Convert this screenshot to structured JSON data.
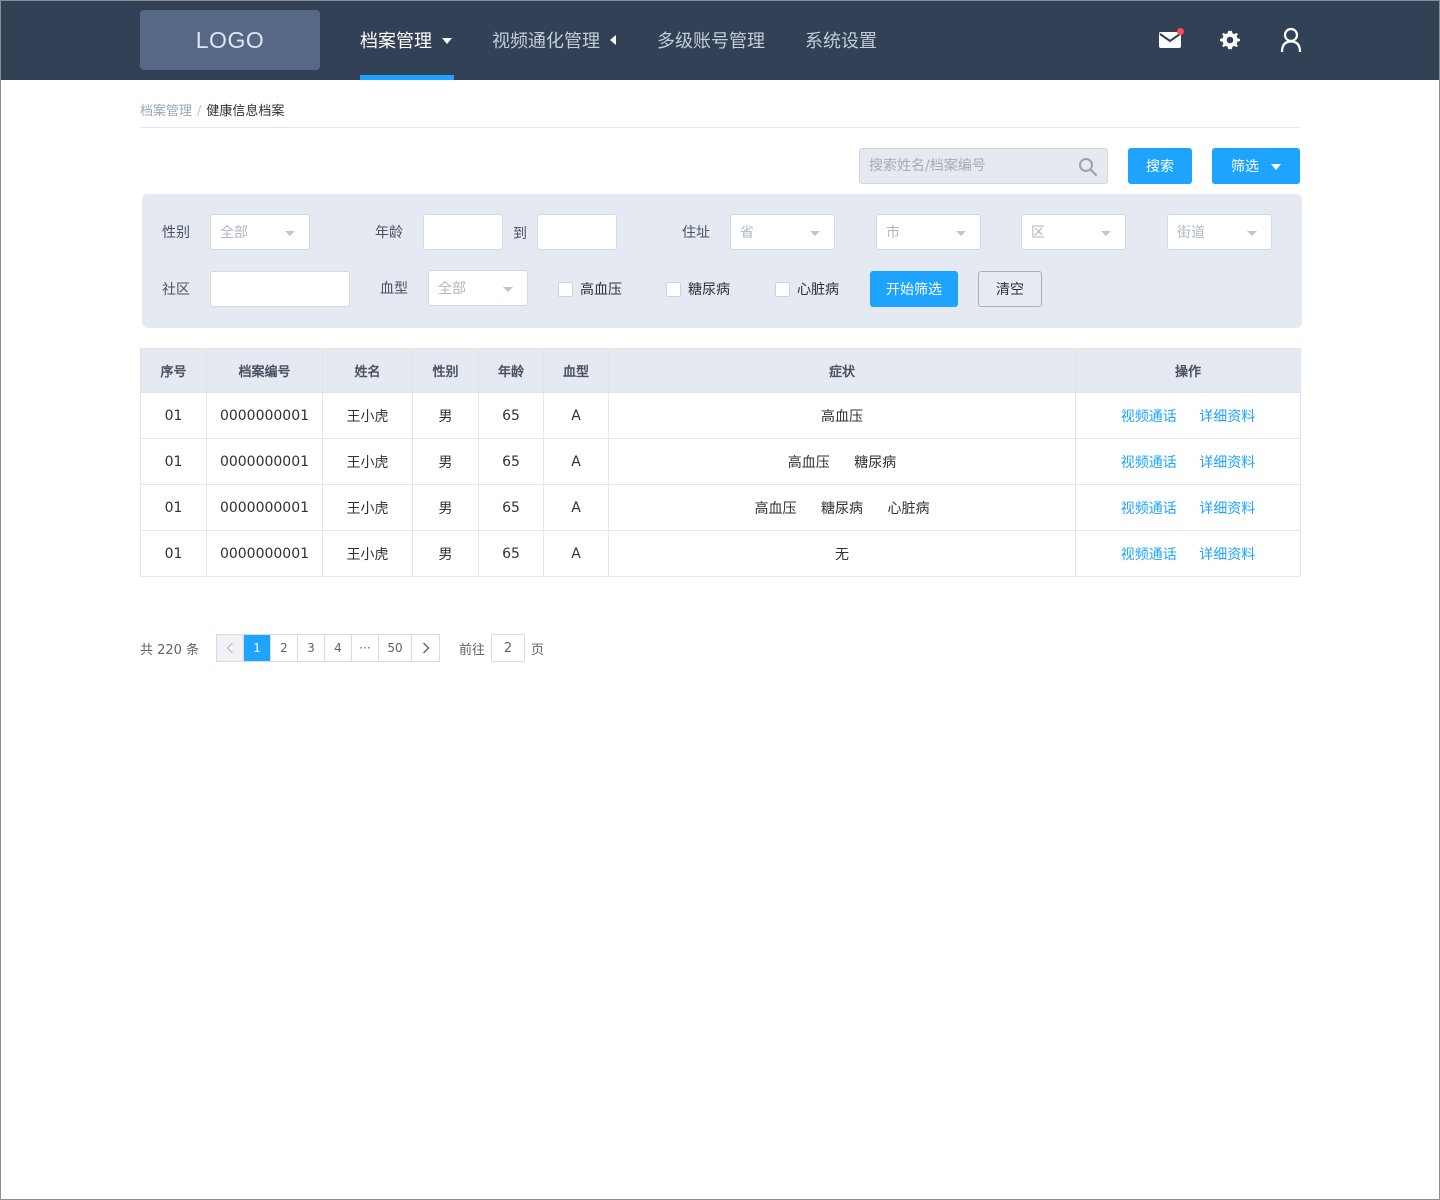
{
  "header": {
    "logo": "LOGO",
    "nav": [
      {
        "label": "档案管理",
        "active": true
      },
      {
        "label": "视频通化管理"
      },
      {
        "label": "多级账号管理"
      },
      {
        "label": "系统设置"
      }
    ],
    "icons": [
      "mail-icon",
      "gear-icon",
      "user-icon"
    ],
    "notification_dot_color": "#ff4d4f"
  },
  "breadcrumb": [
    "档案管理",
    "/",
    "健康信息档案"
  ],
  "search": {
    "placeholder": "搜索姓名/档案编号",
    "search_button": "搜索",
    "filter_button": "筛选"
  },
  "filter": {
    "gender_label": "性别",
    "gender_value": "全部",
    "age_label": "年龄",
    "age_to": "到",
    "address_label": "住址",
    "province": "省",
    "city": "市",
    "district": "区",
    "street": "街道",
    "community_label": "社区",
    "blood_label": "血型",
    "blood_value": "全部",
    "checkboxes": [
      "高血压",
      "糖尿病",
      "心脏病"
    ],
    "start_button": "开始筛选",
    "clear_button": "清空"
  },
  "table": {
    "columns": [
      "序号",
      "档案编号",
      "姓名",
      "性别",
      "年龄",
      "血型",
      "症状",
      "操作"
    ],
    "rows": [
      {
        "no": "01",
        "id": "0000000001",
        "name": "王小虎",
        "gender": "男",
        "age": "65",
        "blood": "A",
        "symptoms": [
          "高血压"
        ]
      },
      {
        "no": "01",
        "id": "0000000001",
        "name": "王小虎",
        "gender": "男",
        "age": "65",
        "blood": "A",
        "symptoms": [
          "高血压",
          "糖尿病"
        ]
      },
      {
        "no": "01",
        "id": "0000000001",
        "name": "王小虎",
        "gender": "男",
        "age": "65",
        "blood": "A",
        "symptoms": [
          "高血压",
          "糖尿病",
          "心脏病"
        ]
      },
      {
        "no": "01",
        "id": "0000000001",
        "name": "王小虎",
        "gender": "男",
        "age": "65",
        "blood": "A",
        "symptoms": [
          "无"
        ]
      }
    ],
    "actions": [
      "视频通话",
      "详细资料"
    ]
  },
  "pagination": {
    "total": "共 220 条",
    "pages": [
      "1",
      "2",
      "3",
      "4",
      "···",
      "50"
    ],
    "current": "1",
    "goto_label": "前往",
    "goto_value": "2",
    "goto_suffix": "页"
  },
  "colors": {
    "topbar": "#334157",
    "accent": "#1ea4ff",
    "panel": "#e5e9f1"
  }
}
